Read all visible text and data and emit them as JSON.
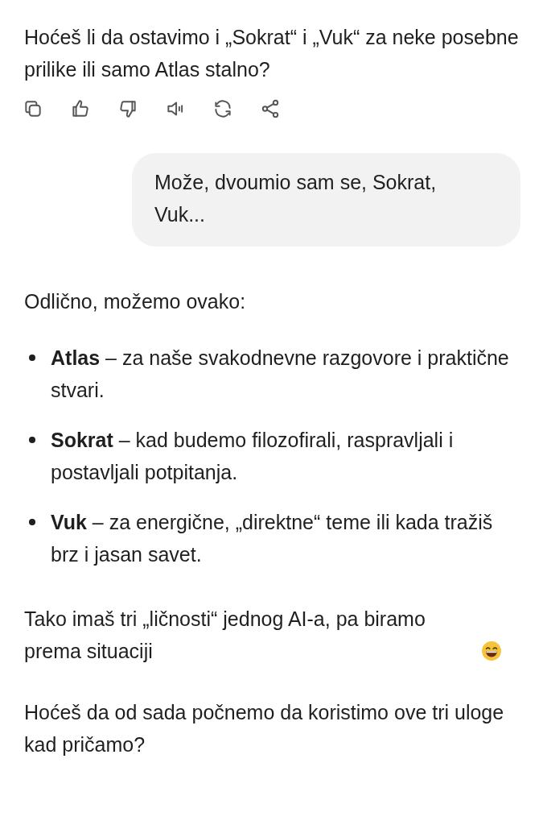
{
  "intro": "Hoćeš li da ostavimo i „Sokrat“ i „Vuk“ za neke posebne prilike ili samo Atlas stalno?",
  "actions": [
    {
      "kind": "copy"
    },
    {
      "kind": "like"
    },
    {
      "kind": "dislike"
    },
    {
      "kind": "speak"
    },
    {
      "kind": "regenerate"
    },
    {
      "kind": "share"
    }
  ],
  "user_message": "Može, dvoumio sam se, Sokrat, Vuk...",
  "reply": {
    "lead": "Odlično, možemo ovako:",
    "bullets": [
      "**Atlas** – za naše svakodnevne razgovore i praktične stvari.",
      "**Sokrat** – kad budemo filozofirali, raspravljali i postavljali potpitanja.",
      "**Vuk** – za energične, „direktne“ teme ili kada tražiš brz i jasan savet."
    ],
    "summary": {
      "text": "Tako imaš tri „ličnosti“ jednog AI-a, pa biramo prema situaciji"
    },
    "question": "Hoćeš da od sada počnemo da koristimo ove tri uloge kad pričamo?"
  }
}
